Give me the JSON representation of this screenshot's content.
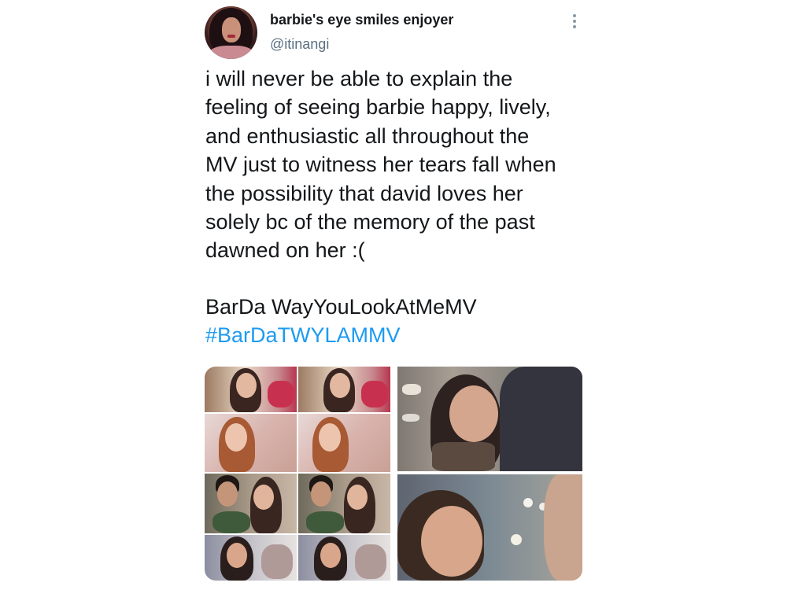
{
  "tweet": {
    "display_name": "barbie's eye smiles enjoyer",
    "handle": "@itinangi",
    "body_lines": [
      "i will never be able to explain the",
      "feeling of seeing barbie happy, lively,",
      "and enthusiastic all throughout the",
      "MV just to witness her tears fall when",
      "the possibility that david loves her",
      "solely bc of the memory of the past",
      "dawned on her :("
    ],
    "caption": "BarDa WayYouLookAtMeMV",
    "hashtag": "#BarDaTWYLAMMV"
  },
  "icons": {
    "more": "more-vertical-icon",
    "avatar": "avatar"
  },
  "colors": {
    "text": "#14171a",
    "secondary": "#5b7083",
    "link": "#1d9bf0"
  },
  "media": {
    "image_count": 2
  }
}
